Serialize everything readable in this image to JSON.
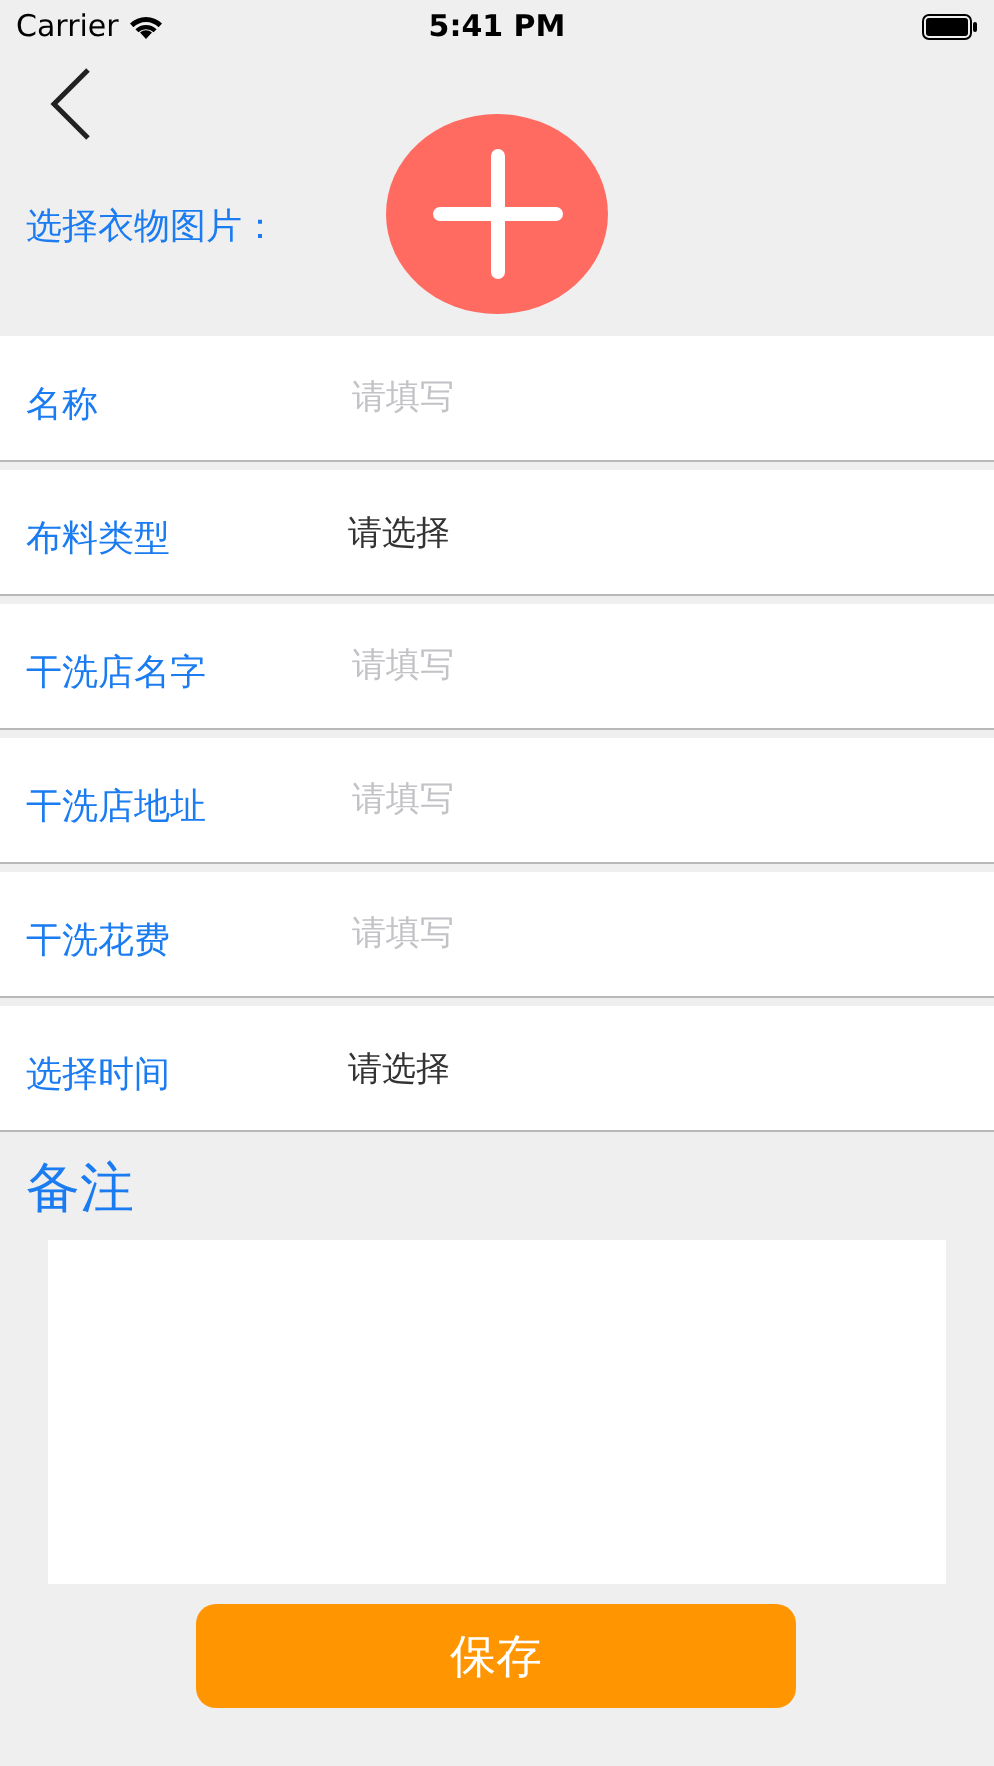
{
  "status_bar": {
    "carrier": "Carrier",
    "time": "5:41 PM"
  },
  "photo_picker": {
    "label": "选择衣物图片："
  },
  "fields": [
    {
      "label": "名称",
      "kind": "input",
      "placeholder": "请填写"
    },
    {
      "label": "布料类型",
      "kind": "select",
      "value": "请选择"
    },
    {
      "label": "干洗店名字",
      "kind": "input",
      "placeholder": "请填写"
    },
    {
      "label": "干洗店地址",
      "kind": "input",
      "placeholder": "请填写"
    },
    {
      "label": "干洗花费",
      "kind": "input",
      "placeholder": "请填写"
    },
    {
      "label": "选择时间",
      "kind": "select",
      "value": "请选择"
    }
  ],
  "remarks": {
    "label": "备注"
  },
  "save_button": "保存"
}
